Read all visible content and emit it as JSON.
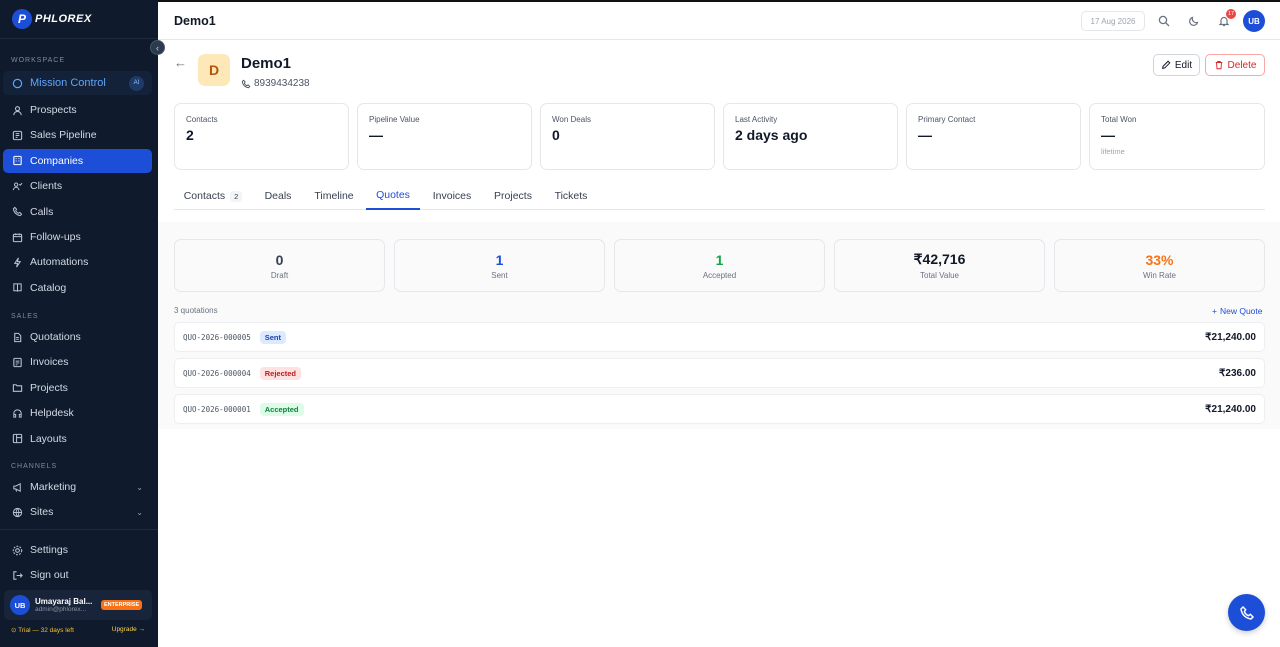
{
  "brand": {
    "name": "PHLOREX"
  },
  "sidebar": {
    "sections": {
      "workspace": "WORKSPACE",
      "sales": "SALES",
      "channels": "CHANNELS"
    },
    "mission": {
      "label": "Mission Control",
      "badge": "AI"
    },
    "workspace_items": [
      {
        "label": "Prospects",
        "icon": "users-icon"
      },
      {
        "label": "Sales Pipeline",
        "icon": "pipeline-icon"
      },
      {
        "label": "Companies",
        "icon": "building-icon",
        "active": true
      },
      {
        "label": "Clients",
        "icon": "clients-icon"
      },
      {
        "label": "Calls",
        "icon": "phone-icon"
      },
      {
        "label": "Follow-ups",
        "icon": "calendar-icon"
      },
      {
        "label": "Automations",
        "icon": "bolt-icon"
      },
      {
        "label": "Catalog",
        "icon": "book-icon"
      }
    ],
    "sales_items": [
      {
        "label": "Quotations",
        "icon": "document-icon"
      },
      {
        "label": "Invoices",
        "icon": "invoice-icon"
      },
      {
        "label": "Projects",
        "icon": "folder-icon"
      },
      {
        "label": "Helpdesk",
        "icon": "headset-icon"
      },
      {
        "label": "Layouts",
        "icon": "layout-icon"
      }
    ],
    "channel_items": [
      {
        "label": "Marketing",
        "icon": "megaphone-icon"
      },
      {
        "label": "Sites",
        "icon": "globe-icon"
      }
    ],
    "settings": "Settings",
    "signout": "Sign out",
    "user": {
      "initials": "UB",
      "name": "Umayaraj Bal...",
      "email": "admin@phlorex...",
      "plan": "ENTERPRISE"
    },
    "trial": {
      "text": "⊙ Trial — 32 days left",
      "upgrade": "Upgrade →"
    }
  },
  "topbar": {
    "title": "Demo1",
    "date": "17 Aug 2026",
    "notifications": "17",
    "avatar": "UB"
  },
  "company": {
    "initial": "D",
    "name": "Demo1",
    "phone": "8939434238"
  },
  "actions": {
    "edit": "Edit",
    "delete": "Delete"
  },
  "stats": [
    {
      "label": "Contacts",
      "value": "2",
      "sub": ""
    },
    {
      "label": "Pipeline Value",
      "value": "—",
      "sub": ""
    },
    {
      "label": "Won Deals",
      "value": "0",
      "sub": ""
    },
    {
      "label": "Last Activity",
      "value": "2 days ago",
      "sub": ""
    },
    {
      "label": "Primary Contact",
      "value": "—",
      "sub": ""
    },
    {
      "label": "Total Won",
      "value": "—",
      "sub": "lifetime"
    }
  ],
  "tabs": [
    {
      "label": "Contacts",
      "count": "2"
    },
    {
      "label": "Deals"
    },
    {
      "label": "Timeline"
    },
    {
      "label": "Quotes",
      "active": true
    },
    {
      "label": "Invoices"
    },
    {
      "label": "Projects"
    },
    {
      "label": "Tickets"
    }
  ],
  "summary": [
    {
      "value": "0",
      "label": "Draft",
      "color": "#374151"
    },
    {
      "value": "1",
      "label": "Sent",
      "color": "#1d4ed8"
    },
    {
      "value": "1",
      "label": "Accepted",
      "color": "#16a34a"
    },
    {
      "value": "₹42,716",
      "label": "Total Value",
      "color": "#111827"
    },
    {
      "value": "33%",
      "label": "Win Rate",
      "color": "#f97316"
    }
  ],
  "quotes": {
    "count_label": "3 quotations",
    "new_label": "New Quote",
    "rows": [
      {
        "id": "QUO-2026-000005",
        "status": "Sent",
        "amount": "₹21,240.00"
      },
      {
        "id": "QUO-2026-000004",
        "status": "Rejected",
        "amount": "₹236.00"
      },
      {
        "id": "QUO-2026-000001",
        "status": "Accepted",
        "amount": "₹21,240.00"
      }
    ]
  }
}
